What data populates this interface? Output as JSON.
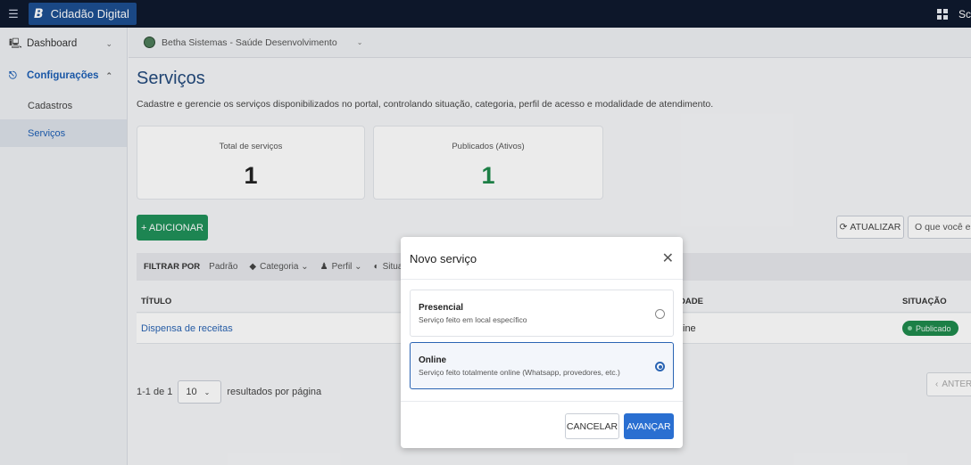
{
  "topbar": {
    "brand_logo": "B",
    "brand_name": "Cidadão Digital",
    "right_text": "Sc"
  },
  "sidebar": {
    "items": [
      {
        "label": "Dashboard",
        "icon": "monitor-icon",
        "expanded": false
      },
      {
        "label": "Configurações",
        "icon": "sitemap-icon",
        "expanded": true
      }
    ],
    "sub_items": [
      {
        "label": "Cadastros",
        "active": false
      },
      {
        "label": "Serviços",
        "active": true
      }
    ]
  },
  "entity_bar": {
    "label": "Betha Sistemas - Saúde Desenvolvimento"
  },
  "page": {
    "title": "Serviços",
    "description": "Cadastre e gerencie os serviços disponibilizados no portal, controlando situação, categoria, perfil de acesso e modalidade de atendimento."
  },
  "cards": [
    {
      "label": "Total de serviços",
      "value": "1"
    },
    {
      "label": "Publicados (Ativos)",
      "value": "1"
    }
  ],
  "toolbar": {
    "add_label": "+ ADICIONAR",
    "refresh_label": "ATUALIZAR",
    "search_placeholder": "O que você est"
  },
  "filters": {
    "title": "FILTRAR POR",
    "items": [
      "Padrão",
      "Categoria",
      "Perfil",
      "Situaç"
    ]
  },
  "table": {
    "headers": [
      "TÍTULO",
      "DADE",
      "SITUAÇÃO"
    ],
    "rows": [
      {
        "title": "Dispensa de receitas",
        "mode": "ine",
        "status": "Publicado"
      }
    ]
  },
  "pager": {
    "range": "1-1 de 1",
    "page_size": "10",
    "suffix": "resultados por página",
    "prev_label": "ANTER"
  },
  "modal": {
    "title": "Novo serviço",
    "options": [
      {
        "name": "Presencial",
        "description": "Serviço feito em local específico",
        "selected": false
      },
      {
        "name": "Online",
        "description": "Serviço feito totalmente online (Whatsapp, provedores, etc.)",
        "selected": true
      }
    ],
    "cancel_label": "CANCELAR",
    "next_label": "AVANÇAR"
  },
  "colors": {
    "topbar": "#0f1a2e",
    "brand": "#1d4f91",
    "primary": "#2a6fd1",
    "success": "#20915a",
    "title": "#234a7c"
  }
}
